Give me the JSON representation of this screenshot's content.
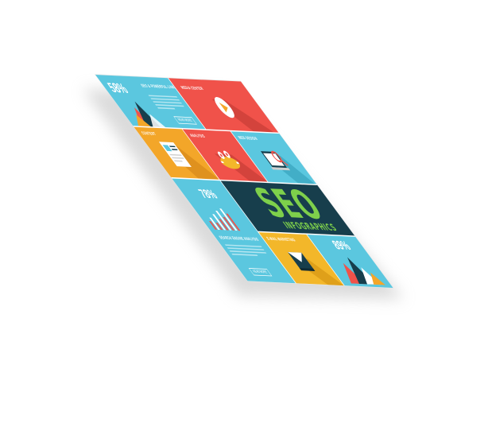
{
  "tiles": {
    "content_strategy": {
      "percent": "58%",
      "title": "SEO & POWERFUL LINKS",
      "button": "READ MORE"
    },
    "media": {
      "title": "MEDIA CENTER"
    },
    "content": {
      "title": "CONTENT"
    },
    "analysis": {
      "title": "ANALYSIS"
    },
    "web_design": {
      "title": "WEB DESIGN"
    },
    "optimization": {
      "percent": "78%",
      "title": "SEARCH ENGINE ANALYSIS",
      "button": "READ MORE"
    },
    "seo_banner": {
      "main": "SEO",
      "sub": "INFOGRAPHICS"
    },
    "email": {
      "title": "E-MAIL MARKETING"
    },
    "growth": {
      "percent": "89%"
    }
  },
  "colors": {
    "cyan": "#5bc7df",
    "red": "#f0524a",
    "orange": "#f3a629",
    "yellow": "#f3b72a",
    "navy": "#173e4c",
    "green": "#7ed04b"
  }
}
